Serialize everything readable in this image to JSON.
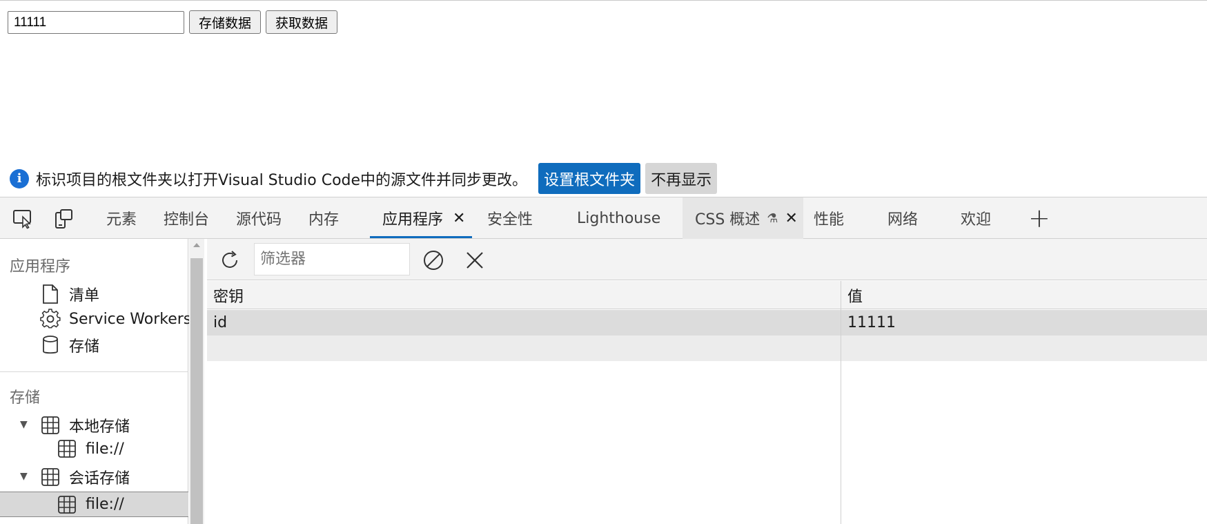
{
  "page": {
    "input_value": "11111",
    "store_button": "存储数据",
    "fetch_button": "获取数据"
  },
  "infobar": {
    "message": "标识项目的根文件夹以打开Visual Studio Code中的源文件并同步更改。",
    "primary_button": "设置根文件夹",
    "secondary_button": "不再显示"
  },
  "tabs": {
    "elements": "元素",
    "console": "控制台",
    "sources": "源代码",
    "memory": "内存",
    "application": "应用程序",
    "security": "安全性",
    "lighthouse": "Lighthouse",
    "css_overview": "CSS 概述",
    "performance": "性能",
    "network": "网络",
    "welcome": "欢迎",
    "active": "application"
  },
  "sidebar": {
    "application_title": "应用程序",
    "application_items": [
      {
        "label": "清单",
        "icon": "document-icon"
      },
      {
        "label": "Service Workers",
        "icon": "gear-icon"
      },
      {
        "label": "存储",
        "icon": "database-icon"
      }
    ],
    "storage_title": "存储",
    "local_storage": {
      "label": "本地存储",
      "child": "file://"
    },
    "session_storage": {
      "label": "会话存储",
      "child": "file://"
    }
  },
  "toolbar": {
    "filter_placeholder": "筛选器"
  },
  "table": {
    "columns": [
      "密钥",
      "值"
    ],
    "rows": [
      {
        "key": "id",
        "value": "11111"
      }
    ]
  },
  "colors": {
    "accent": "#0f6cbd",
    "info_icon": "#1a6fd4",
    "selected_row": "#dcdcdc"
  }
}
